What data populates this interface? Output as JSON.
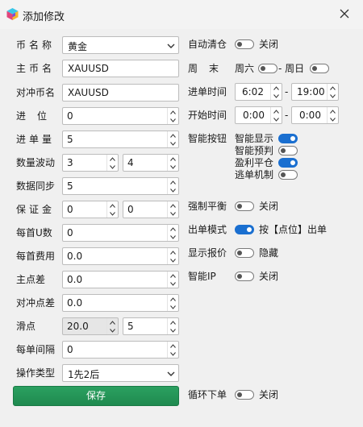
{
  "window": {
    "title": "添加修改",
    "close_glyph": "✕"
  },
  "form": {
    "symbol_name": {
      "label": "币名称",
      "value": "黄金"
    },
    "main_symbol": {
      "label": "主币名",
      "value": "XAUUSD"
    },
    "hedge_symbol": {
      "label": "对冲币名",
      "value": "XAUUSD"
    },
    "entry_level": {
      "label": "进位",
      "value": "0"
    },
    "entry_volume": {
      "label": "进单量",
      "value": "5"
    },
    "volume_wave": {
      "label": "数量波动",
      "value_a": "3",
      "value_b": "4"
    },
    "data_sync": {
      "label": "数据同步",
      "value": "5"
    },
    "margin": {
      "label": "保证金",
      "value_a": "0",
      "value_b": "0"
    },
    "per_u": {
      "label": "每首U数",
      "value": "0"
    },
    "per_fee": {
      "label": "每首费用",
      "value": "0.0"
    },
    "main_spread": {
      "label": "主点差",
      "value": "0.0"
    },
    "hedge_spread": {
      "label": "对冲点差",
      "value": "0.0"
    },
    "slippage": {
      "label": "滑点",
      "value_a": "20.0",
      "value_b": "5"
    },
    "order_interval": {
      "label": "每单间隔",
      "value": "0"
    },
    "op_type": {
      "label": "操作类型",
      "value": "1先2后"
    },
    "save_label": "保存"
  },
  "settings": {
    "auto_clear": {
      "label": "自动清仓",
      "state_text": "关闭",
      "on": false
    },
    "weekend": {
      "label": "周末",
      "saturday": "周六",
      "sunday": "- 周日",
      "saturday_on": false,
      "sunday_on": false
    },
    "entry_time": {
      "label": "进单时间",
      "start": "6:02",
      "dash": "-",
      "end": "19:00"
    },
    "start_time": {
      "label": "开始时间",
      "start": "0:00",
      "dash": "-",
      "end": "0:00"
    },
    "smart_buttons": {
      "label": "智能按钮",
      "items": [
        {
          "label": "智能显示",
          "on": true
        },
        {
          "label": "智能预判",
          "on": false
        },
        {
          "label": "盈利平仓",
          "on": true
        },
        {
          "label": "逃单机制",
          "on": false
        }
      ]
    },
    "force_balance": {
      "label": "强制平衡",
      "state_text": "关闭",
      "on": false
    },
    "order_mode": {
      "label": "出单模式",
      "state_text": "按【点位】出单",
      "on": true
    },
    "show_quote": {
      "label": "显示报价",
      "state_text": "隐藏",
      "on": false
    },
    "smart_ip": {
      "label": "智能IP",
      "state_text": "关闭",
      "on": false
    },
    "loop_order": {
      "label": "循环下单",
      "state_text": "关闭",
      "on": false
    }
  },
  "colors": {
    "accent": "#1a6fd0",
    "save_button": "#1f8a4f",
    "background": "#f0f0f0"
  }
}
